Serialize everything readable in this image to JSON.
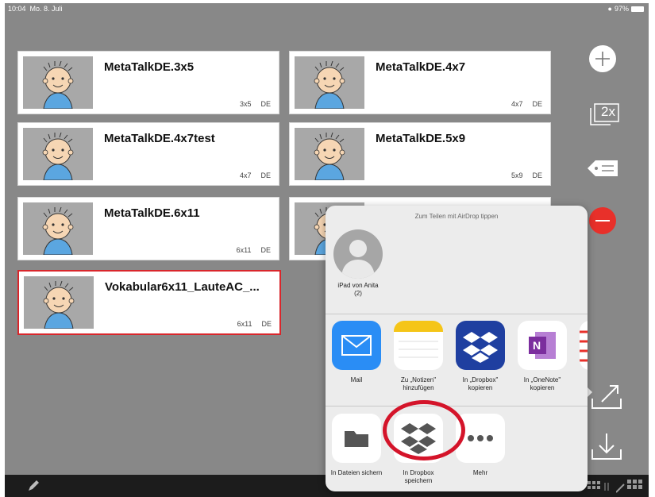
{
  "status_bar": {
    "time": "10:04",
    "date": "Mo. 8. Juli",
    "battery": "97%"
  },
  "boards": [
    {
      "title": "MetaTalkDE.3x5",
      "size": "3x5",
      "lang": "DE"
    },
    {
      "title": "MetaTalkDE.4x7",
      "size": "4x7",
      "lang": "DE"
    },
    {
      "title": "MetaTalkDE.4x7test",
      "size": "4x7",
      "lang": "DE"
    },
    {
      "title": "MetaTalkDE.5x9",
      "size": "5x9",
      "lang": "DE"
    },
    {
      "title": "MetaTalkDE.6x11",
      "size": "6x11",
      "lang": "DE"
    },
    {
      "title": "",
      "size": "",
      "lang": ""
    },
    {
      "title": "Vokabular6x11_LauteAC_...",
      "size": "6x11",
      "lang": "DE",
      "selected": true
    }
  ],
  "toolbar": {
    "duplicate_label": "2x"
  },
  "share_sheet": {
    "airdrop_hint": "Zum Teilen mit AirDrop tippen",
    "contact": {
      "name": "iPad von Anita",
      "count": "(2)"
    },
    "apps": [
      {
        "label": "Mail",
        "icon": "mail-icon",
        "color": "#2a8df5"
      },
      {
        "label": "Zu „Notizen\" hinzufügen",
        "icon": "notes-icon",
        "color": "#ffffff"
      },
      {
        "label": "In „Dropbox\" kopieren",
        "icon": "dropbox-icon",
        "color": "#1f3fa0"
      },
      {
        "label": "In „OneNote\" kopieren",
        "icon": "onenote-icon",
        "color": "#ffffff"
      },
      {
        "label": "In",
        "icon": "more-app-icon",
        "color": "#ffffff"
      }
    ],
    "actions": [
      {
        "label": "In Dateien sichern",
        "icon": "folder-icon"
      },
      {
        "label": "In Dropbox speichern",
        "icon": "dropbox-save-icon"
      },
      {
        "label": "Mehr",
        "icon": "more-icon"
      }
    ]
  }
}
